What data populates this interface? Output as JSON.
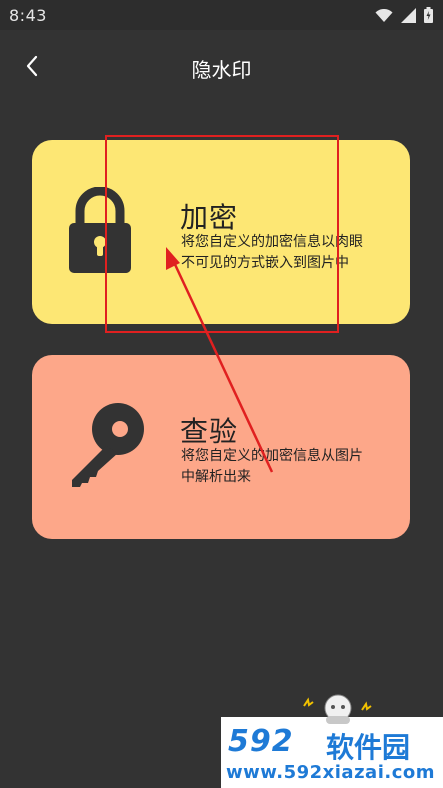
{
  "status_bar": {
    "time": "8:43",
    "icons": [
      "wifi-icon",
      "cellular-signal-icon",
      "battery-icon"
    ]
  },
  "header": {
    "title": "隐水印",
    "back_icon": "chevron-left-icon"
  },
  "cards": {
    "encrypt": {
      "title": "加密",
      "desc_line1": "将您自定义的加密信息以肉眼",
      "desc_line2": "不可见的方式嵌入到图片中",
      "icon": "lock-icon",
      "color": "#fde774"
    },
    "verify": {
      "title": "查验",
      "desc_line1": "将您自定义的加密信息从图片",
      "desc_line2": "中解析出来",
      "icon": "key-icon",
      "color": "#fda789"
    }
  },
  "annotation": {
    "color": "#e02020"
  },
  "watermark": {
    "logo_digits": "592",
    "logo_text": "软件园",
    "url": "www.592xiazai.com",
    "color": "#1e7ad6"
  },
  "colors": {
    "background": "#333333",
    "text_dark": "#222222"
  }
}
